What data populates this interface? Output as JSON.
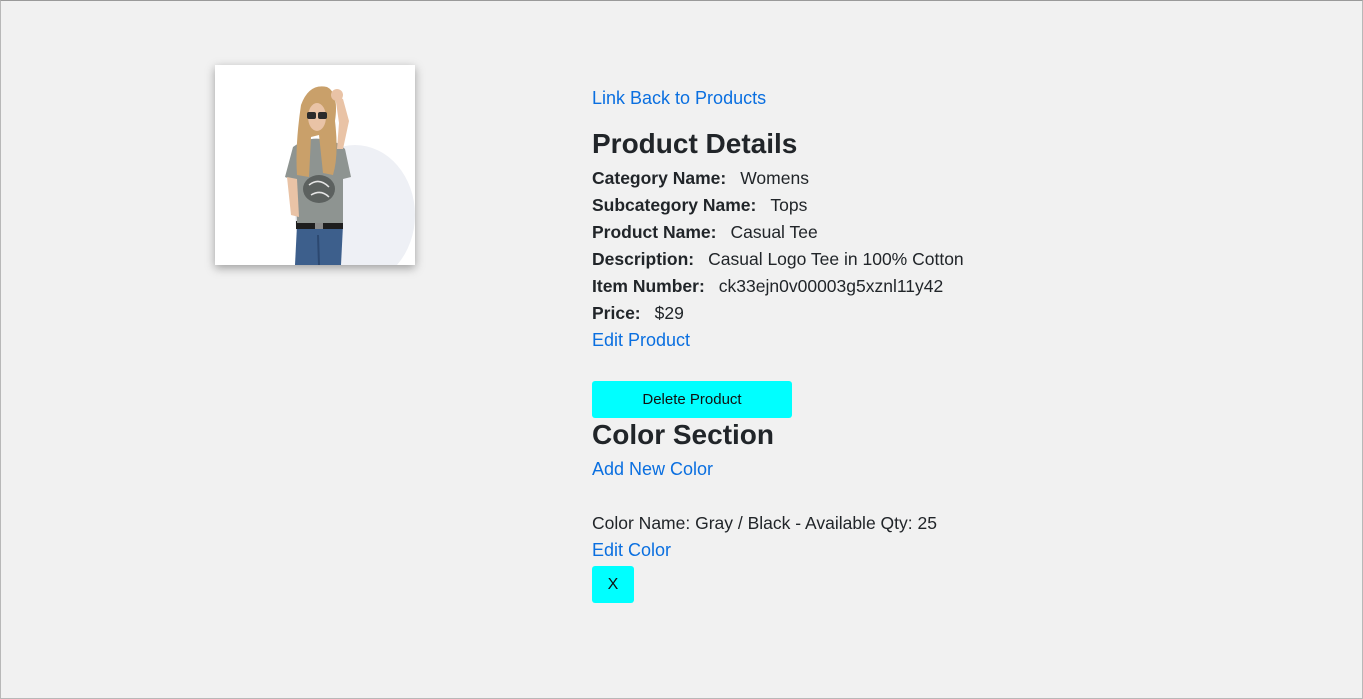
{
  "product_image": {
    "alt": "Casual Tee product photo"
  },
  "back_link": "Link Back to Products",
  "details": {
    "title": "Product Details",
    "fields": [
      {
        "label": "Category Name:",
        "value": "Womens"
      },
      {
        "label": "Subcategory Name:",
        "value": "Tops"
      },
      {
        "label": "Product Name:",
        "value": "Casual Tee"
      },
      {
        "label": "Description:",
        "value": "Casual Logo Tee in 100% Cotton"
      },
      {
        "label": "Item Number:",
        "value": "ck33ejn0v00003g5xznl11y42"
      },
      {
        "label": "Price:",
        "value": "$29"
      }
    ],
    "edit_link": "Edit Product",
    "delete_button": "Delete Product"
  },
  "colors": {
    "title": "Color Section",
    "add_link": "Add New Color",
    "items": [
      {
        "text": "Color Name: Gray / Black - Available Qty: 25",
        "edit_link": "Edit Color",
        "remove_button": "X"
      }
    ]
  },
  "theme": {
    "link_color": "#0a6fe0",
    "button_color": "#00ffff",
    "background": "#f1f1f1"
  }
}
